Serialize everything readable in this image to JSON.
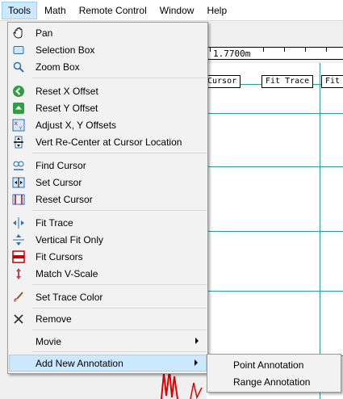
{
  "menubar": {
    "items": [
      "Tools",
      "Math",
      "Remote Control",
      "Window",
      "Help"
    ]
  },
  "plot": {
    "ruler_label": "1.7700m",
    "buttons": [
      "Cursor",
      "Fit Trace",
      "Fit"
    ],
    "grid_color": "#2e9e96",
    "trace_color": "#e00000"
  },
  "tools_menu": {
    "items": [
      {
        "label": "Pan",
        "icon": "hand-icon"
      },
      {
        "label": "Selection Box",
        "icon": "selection-box-icon"
      },
      {
        "label": "Zoom Box",
        "icon": "magnifier-icon"
      },
      {
        "label": "Reset X Offset",
        "icon": "green-left-arrow-icon"
      },
      {
        "label": "Reset Y Offset",
        "icon": "green-up-arrow-icon"
      },
      {
        "label": "Adjust X, Y Offsets",
        "icon": "xy-offset-icon"
      },
      {
        "label": "Vert Re-Center at Cursor Location",
        "icon": "vertical-recenter-icon"
      },
      {
        "label": "Find Cursor",
        "icon": "find-cursor-icon"
      },
      {
        "label": "Set Cursor",
        "icon": "set-cursor-icon"
      },
      {
        "label": "Reset Cursor",
        "icon": "reset-cursor-icon"
      },
      {
        "label": "Fit Trace",
        "icon": "fit-trace-icon"
      },
      {
        "label": "Vertical Fit Only",
        "icon": "vertical-fit-icon"
      },
      {
        "label": "Fit Cursors",
        "icon": "fit-cursors-icon"
      },
      {
        "label": "Match V-Scale",
        "icon": "match-vscale-icon"
      },
      {
        "label": "Set Trace Color",
        "icon": "paint-brush-icon"
      },
      {
        "label": "Remove",
        "icon": "x-icon"
      },
      {
        "label": "Movie",
        "icon": ""
      },
      {
        "label": "Add New Annotation",
        "icon": ""
      }
    ]
  },
  "annotation_submenu": {
    "items": [
      "Point Annotation",
      "Range Annotation"
    ]
  }
}
